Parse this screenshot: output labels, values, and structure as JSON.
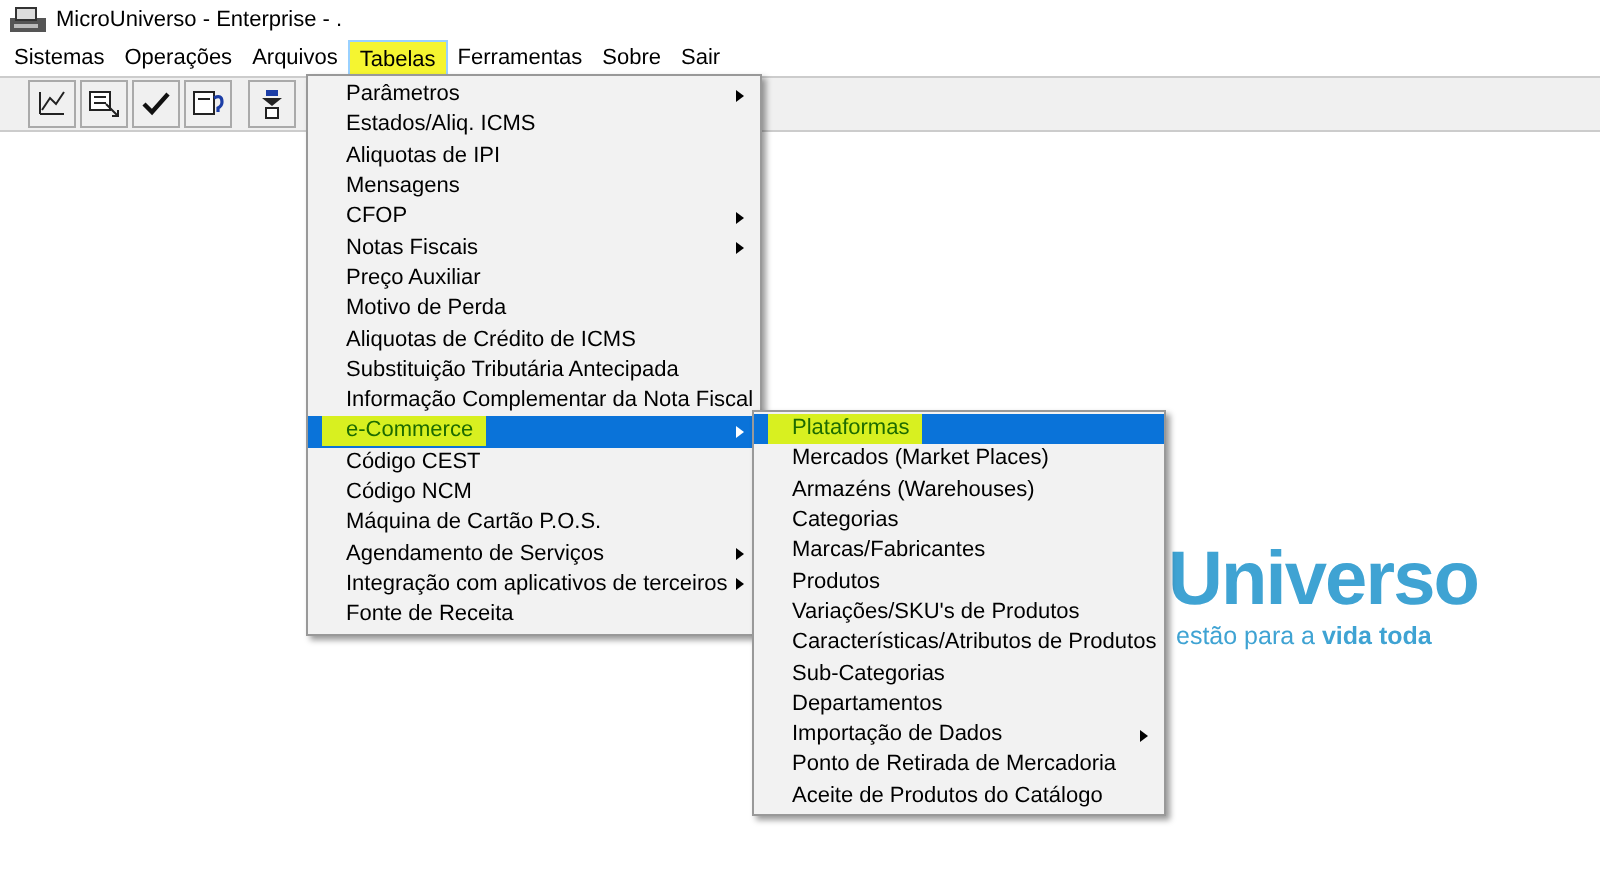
{
  "window": {
    "title": "MicroUniverso - Enterprise - ."
  },
  "menubar": [
    {
      "label": "Sistemas",
      "selected": false,
      "marked": false
    },
    {
      "label": "Operações",
      "selected": false,
      "marked": false
    },
    {
      "label": "Arquivos",
      "selected": false,
      "marked": false
    },
    {
      "label": "Tabelas",
      "selected": true,
      "marked": true
    },
    {
      "label": "Ferramentas",
      "selected": false,
      "marked": false
    },
    {
      "label": "Sobre",
      "selected": false,
      "marked": false
    },
    {
      "label": "Sair",
      "selected": false,
      "marked": false
    }
  ],
  "toolbar": [
    {
      "kind": "chart"
    },
    {
      "kind": "form"
    },
    {
      "kind": "check"
    },
    {
      "kind": "query"
    },
    {
      "kind": "down"
    }
  ],
  "menu": [
    {
      "label": "Parâmetros",
      "submenu": true,
      "selected": false,
      "marked": false
    },
    {
      "label": "Estados/Aliq. ICMS",
      "submenu": false,
      "selected": false,
      "marked": false
    },
    {
      "label": "Aliquotas de IPI",
      "submenu": false,
      "selected": false,
      "marked": false
    },
    {
      "label": "Mensagens",
      "submenu": false,
      "selected": false,
      "marked": false
    },
    {
      "label": "CFOP",
      "submenu": true,
      "selected": false,
      "marked": false
    },
    {
      "label": "Notas Fiscais",
      "submenu": true,
      "selected": false,
      "marked": false
    },
    {
      "label": "Preço  Auxiliar",
      "submenu": false,
      "selected": false,
      "marked": false
    },
    {
      "label": "Motivo de Perda",
      "submenu": false,
      "selected": false,
      "marked": false
    },
    {
      "label": "Aliquotas de Crédito de ICMS",
      "submenu": false,
      "selected": false,
      "marked": false
    },
    {
      "label": "Substituição Tributária Antecipada",
      "submenu": false,
      "selected": false,
      "marked": false
    },
    {
      "label": "Informação Complementar da Nota Fiscal",
      "submenu": false,
      "selected": false,
      "marked": false
    },
    {
      "label": "e-Commerce",
      "submenu": true,
      "selected": true,
      "marked": true
    },
    {
      "label": "Código CEST",
      "submenu": false,
      "selected": false,
      "marked": false
    },
    {
      "label": "Código NCM",
      "submenu": false,
      "selected": false,
      "marked": false
    },
    {
      "label": "Máquina de Cartão P.O.S.",
      "submenu": false,
      "selected": false,
      "marked": false
    },
    {
      "label": "Agendamento de Serviços",
      "submenu": true,
      "selected": false,
      "marked": false
    },
    {
      "label": "Integração com aplicativos de terceiros",
      "submenu": true,
      "selected": false,
      "marked": false
    },
    {
      "label": "Fonte de Receita",
      "submenu": false,
      "selected": false,
      "marked": false
    }
  ],
  "submenu": [
    {
      "label": "Plataformas",
      "submenu": false,
      "selected": true,
      "marked": true
    },
    {
      "label": "Mercados (Market Places)",
      "submenu": false,
      "selected": false,
      "marked": false
    },
    {
      "label": "Armazéns (Warehouses)",
      "submenu": false,
      "selected": false,
      "marked": false
    },
    {
      "label": "Categorias",
      "submenu": false,
      "selected": false,
      "marked": false
    },
    {
      "label": "Marcas/Fabricantes",
      "submenu": false,
      "selected": false,
      "marked": false
    },
    {
      "label": "Produtos",
      "submenu": false,
      "selected": false,
      "marked": false
    },
    {
      "label": "Variações/SKU's de Produtos",
      "submenu": false,
      "selected": false,
      "marked": false
    },
    {
      "label": "Características/Atributos de Produtos",
      "submenu": false,
      "selected": false,
      "marked": false
    },
    {
      "label": "Sub-Categorias",
      "submenu": false,
      "selected": false,
      "marked": false
    },
    {
      "label": "Departamentos",
      "submenu": false,
      "selected": false,
      "marked": false
    },
    {
      "label": "Importação de Dados",
      "submenu": true,
      "selected": false,
      "marked": false
    },
    {
      "label": "Ponto de Retirada de Mercadoria",
      "submenu": false,
      "selected": false,
      "marked": false
    },
    {
      "label": "Aceite de Produtos do Catálogo",
      "submenu": false,
      "selected": false,
      "marked": false
    }
  ],
  "logo": {
    "name": "Universo",
    "tagline": "estão para a **vida toda**"
  }
}
